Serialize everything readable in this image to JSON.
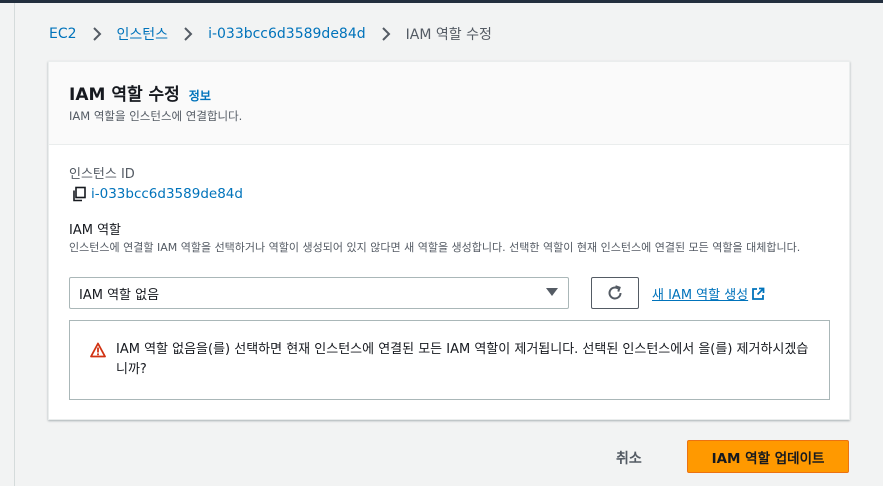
{
  "breadcrumb": {
    "items": [
      "EC2",
      "인스턴스",
      "i-033bcc6d3589de84d"
    ],
    "current": "IAM 역할 수정"
  },
  "panel": {
    "title": "IAM 역할 수정",
    "info_link": "정보",
    "description": "IAM 역할을 인스턴스에 연결합니다."
  },
  "instance": {
    "label": "인스턴스 ID",
    "id": "i-033bcc6d3589de84d"
  },
  "iam_role": {
    "label": "IAM 역할",
    "description": "인스턴스에 연결할 IAM 역할을 선택하거나 역할이 생성되어 있지 않다면 새 역할을 생성합니다. 선택한 역할이 현재 인스턴스에 연결된 모든 역할을 대체합니다.",
    "selected": "IAM 역할 없음",
    "create_link": "새 IAM 역할 생성"
  },
  "alert": {
    "message": "IAM 역할 없음을(를) 선택하면 현재 인스턴스에 연결된 모든 IAM 역할이 제거됩니다. 선택된 인스턴스에서 을(를) 제거하시겠습니까?"
  },
  "actions": {
    "cancel": "취소",
    "update": "IAM 역할 업데이트"
  },
  "colors": {
    "link": "#0073bb",
    "primary": "#ff9900",
    "warning": "#d13212",
    "topbar": "#232f3e"
  },
  "icons": [
    "chevron-right-icon",
    "copy-icon",
    "caret-down-icon",
    "refresh-icon",
    "external-link-icon",
    "warning-icon"
  ]
}
